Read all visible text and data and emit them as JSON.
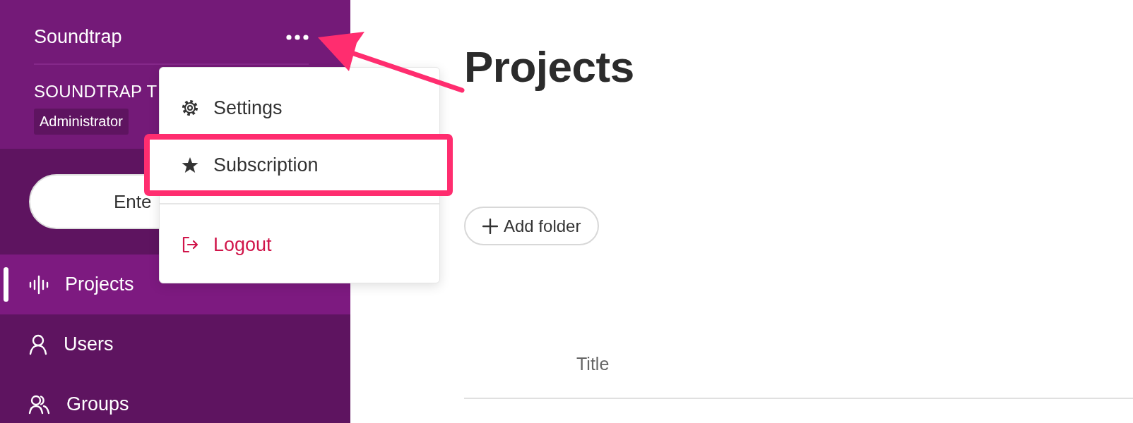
{
  "sidebar": {
    "app_name": "Soundtrap",
    "team_name": "SOUNDTRAP T",
    "role_badge": "Administrator",
    "enter_button": "Ente",
    "nav_items": [
      {
        "label": "Projects",
        "selected": true
      },
      {
        "label": "Users",
        "selected": false
      },
      {
        "label": "Groups",
        "selected": false
      }
    ]
  },
  "menu": {
    "items": [
      {
        "label": "Settings",
        "kind": "normal",
        "highlighted": false
      },
      {
        "label": "Subscription",
        "kind": "normal",
        "highlighted": true
      },
      {
        "label": "Logout",
        "kind": "danger",
        "highlighted": false
      }
    ]
  },
  "main": {
    "title": "Projects",
    "add_folder_button": "Add folder",
    "table": {
      "columns": [
        "Title"
      ]
    }
  }
}
